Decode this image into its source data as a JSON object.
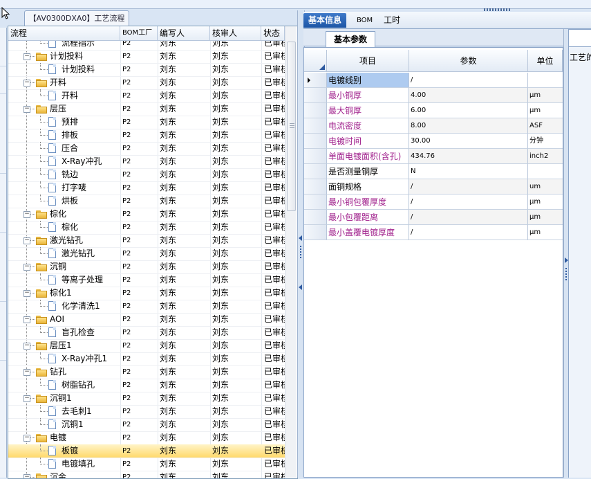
{
  "process_tab": {
    "label": "【AV0300DXA0】工艺流程"
  },
  "left_table": {
    "columns": [
      "流程",
      "BOM工厂",
      "编写人",
      "核审人",
      "状态"
    ],
    "rows": [
      {
        "level": 2,
        "type": "doc",
        "name": "流程指示",
        "bom": "P2",
        "author": "刘东",
        "reviewer": "刘东",
        "status": "已审核"
      },
      {
        "level": 1,
        "type": "folder",
        "name": "计划投料",
        "bom": "P2",
        "author": "刘东",
        "reviewer": "刘东",
        "status": "已审核"
      },
      {
        "level": 2,
        "type": "doc",
        "name": "计划投料",
        "bom": "P2",
        "author": "刘东",
        "reviewer": "刘东",
        "status": "已审核"
      },
      {
        "level": 1,
        "type": "folder",
        "name": "开料",
        "bom": "P2",
        "author": "刘东",
        "reviewer": "刘东",
        "status": "已审核"
      },
      {
        "level": 2,
        "type": "doc",
        "name": "开料",
        "bom": "P2",
        "author": "刘东",
        "reviewer": "刘东",
        "status": "已审核"
      },
      {
        "level": 1,
        "type": "folder",
        "name": "层压",
        "bom": "P2",
        "author": "刘东",
        "reviewer": "刘东",
        "status": "已审核"
      },
      {
        "level": 2,
        "type": "doc",
        "name": "预排",
        "bom": "P2",
        "author": "刘东",
        "reviewer": "刘东",
        "status": "已审核"
      },
      {
        "level": 2,
        "type": "doc",
        "name": "排板",
        "bom": "P2",
        "author": "刘东",
        "reviewer": "刘东",
        "status": "已审核"
      },
      {
        "level": 2,
        "type": "doc",
        "name": "压合",
        "bom": "P2",
        "author": "刘东",
        "reviewer": "刘东",
        "status": "已审核"
      },
      {
        "level": 2,
        "type": "doc",
        "name": "X-Ray冲孔",
        "bom": "P2",
        "author": "刘东",
        "reviewer": "刘东",
        "status": "已审核"
      },
      {
        "level": 2,
        "type": "doc",
        "name": "铣边",
        "bom": "P2",
        "author": "刘东",
        "reviewer": "刘东",
        "status": "已审核"
      },
      {
        "level": 2,
        "type": "doc",
        "name": "打字唛",
        "bom": "P2",
        "author": "刘东",
        "reviewer": "刘东",
        "status": "已审核"
      },
      {
        "level": 2,
        "type": "doc",
        "name": "烘板",
        "bom": "P2",
        "author": "刘东",
        "reviewer": "刘东",
        "status": "已审核"
      },
      {
        "level": 1,
        "type": "folder",
        "name": "棕化",
        "bom": "P2",
        "author": "刘东",
        "reviewer": "刘东",
        "status": "已审核"
      },
      {
        "level": 2,
        "type": "doc",
        "name": "棕化",
        "bom": "P2",
        "author": "刘东",
        "reviewer": "刘东",
        "status": "已审核"
      },
      {
        "level": 1,
        "type": "folder",
        "name": "激光钻孔",
        "bom": "P2",
        "author": "刘东",
        "reviewer": "刘东",
        "status": "已审核"
      },
      {
        "level": 2,
        "type": "doc",
        "name": "激光钻孔",
        "bom": "P2",
        "author": "刘东",
        "reviewer": "刘东",
        "status": "已审核"
      },
      {
        "level": 1,
        "type": "folder",
        "name": "沉铜",
        "bom": "P2",
        "author": "刘东",
        "reviewer": "刘东",
        "status": "已审核"
      },
      {
        "level": 2,
        "type": "doc",
        "name": "等离子处理",
        "bom": "P2",
        "author": "刘东",
        "reviewer": "刘东",
        "status": "已审核"
      },
      {
        "level": 1,
        "type": "folder",
        "name": "棕化1",
        "bom": "P2",
        "author": "刘东",
        "reviewer": "刘东",
        "status": "已审核"
      },
      {
        "level": 2,
        "type": "doc",
        "name": "化学清洗1",
        "bom": "P2",
        "author": "刘东",
        "reviewer": "刘东",
        "status": "已审核"
      },
      {
        "level": 1,
        "type": "folder",
        "name": "AOI",
        "bom": "P2",
        "author": "刘东",
        "reviewer": "刘东",
        "status": "已审核"
      },
      {
        "level": 2,
        "type": "doc",
        "name": "盲孔检查",
        "bom": "P2",
        "author": "刘东",
        "reviewer": "刘东",
        "status": "已审核"
      },
      {
        "level": 1,
        "type": "folder",
        "name": "层压1",
        "bom": "P2",
        "author": "刘东",
        "reviewer": "刘东",
        "status": "已审核"
      },
      {
        "level": 2,
        "type": "doc",
        "name": "X-Ray冲孔1",
        "bom": "P2",
        "author": "刘东",
        "reviewer": "刘东",
        "status": "已审核"
      },
      {
        "level": 1,
        "type": "folder",
        "name": "钻孔",
        "bom": "P2",
        "author": "刘东",
        "reviewer": "刘东",
        "status": "已审核"
      },
      {
        "level": 2,
        "type": "doc",
        "name": "树脂钻孔",
        "bom": "P2",
        "author": "刘东",
        "reviewer": "刘东",
        "status": "已审核"
      },
      {
        "level": 1,
        "type": "folder",
        "name": "沉铜1",
        "bom": "P2",
        "author": "刘东",
        "reviewer": "刘东",
        "status": "已审核"
      },
      {
        "level": 2,
        "type": "doc",
        "name": "去毛刺1",
        "bom": "P2",
        "author": "刘东",
        "reviewer": "刘东",
        "status": "已审核"
      },
      {
        "level": 2,
        "type": "doc",
        "name": "沉铜1",
        "bom": "P2",
        "author": "刘东",
        "reviewer": "刘东",
        "status": "已审核"
      },
      {
        "level": 1,
        "type": "folder",
        "name": "电镀",
        "bom": "P2",
        "author": "刘东",
        "reviewer": "刘东",
        "status": "已审核"
      },
      {
        "level": 2,
        "type": "doc",
        "name": "板镀",
        "bom": "P2",
        "author": "刘东",
        "reviewer": "刘东",
        "status": "已审核",
        "selected": true
      },
      {
        "level": 2,
        "type": "doc",
        "name": "电镀填孔",
        "bom": "P2",
        "author": "刘东",
        "reviewer": "刘东",
        "status": "已审核"
      },
      {
        "level": 1,
        "type": "folder",
        "name": "沉金",
        "bom": "P2",
        "author": "刘东",
        "reviewer": "刘东",
        "status": "已审核"
      }
    ]
  },
  "right_tabs": [
    {
      "label": "基本信息",
      "active": true
    },
    {
      "label": "BOM",
      "active": false
    },
    {
      "label": "工时",
      "active": false
    }
  ],
  "sub_tab": {
    "label": "基本参数"
  },
  "param_grid": {
    "columns": [
      "项目",
      "参数",
      "单位"
    ],
    "rows": [
      {
        "item": "电镀线别",
        "param": "/",
        "unit": "",
        "highlight": false
      },
      {
        "item": "最小铜厚",
        "param": "4.00",
        "unit": "μm",
        "highlight": true
      },
      {
        "item": "最大铜厚",
        "param": "6.00",
        "unit": "μm",
        "highlight": true
      },
      {
        "item": "电流密度",
        "param": "8.00",
        "unit": "ASF",
        "highlight": true
      },
      {
        "item": "电镀时间",
        "param": "30.00",
        "unit": "分钟",
        "highlight": true
      },
      {
        "item": "单面电镀面积(含孔)",
        "param": "434.76",
        "unit": "inch2",
        "highlight": true
      },
      {
        "item": "是否测量铜厚",
        "param": "N",
        "unit": "",
        "highlight": false
      },
      {
        "item": "面铜规格",
        "param": "/",
        "unit": "um",
        "highlight": false
      },
      {
        "item": "最小铜包覆厚度",
        "param": "/",
        "unit": "μm",
        "highlight": true
      },
      {
        "item": "最小包覆距离",
        "param": "/",
        "unit": "μm",
        "highlight": true
      },
      {
        "item": "最小盖覆电镀厚度",
        "param": "/",
        "unit": "μm",
        "highlight": true
      }
    ]
  },
  "right_side": {
    "label": "工艺的"
  },
  "colors": {
    "highlight_text": "#a0208c",
    "selected_row": "#ffd96b",
    "active_tab": "#1d56a6"
  }
}
